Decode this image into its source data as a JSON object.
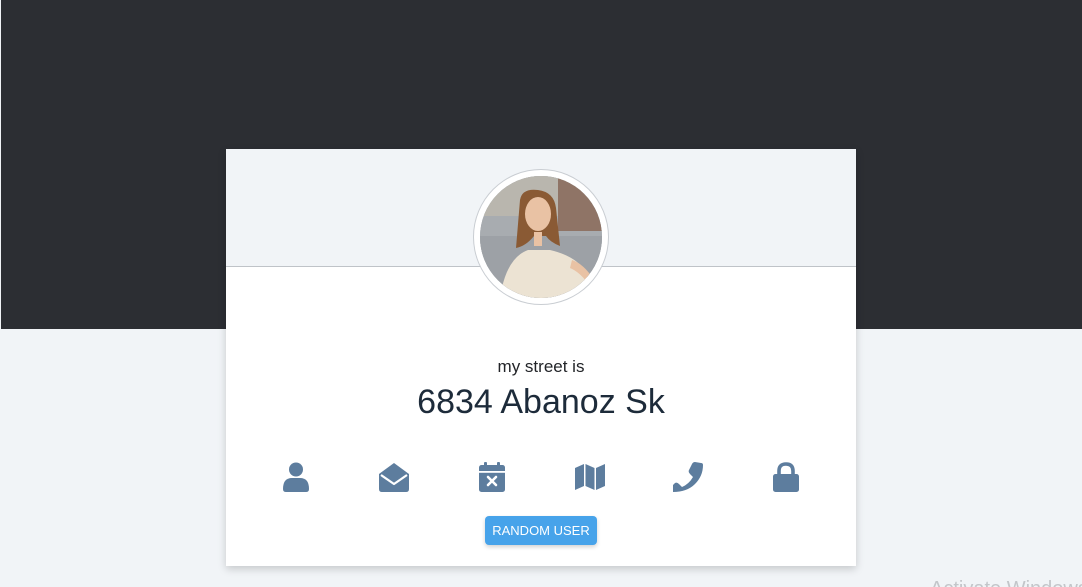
{
  "profile": {
    "label": "my street is",
    "value": "6834 Abanoz Sk",
    "avatar_alt": "user portrait"
  },
  "icons": [
    {
      "name": "user-icon"
    },
    {
      "name": "envelope-open-icon"
    },
    {
      "name": "calendar-times-icon"
    },
    {
      "name": "map-icon"
    },
    {
      "name": "phone-icon"
    },
    {
      "name": "lock-icon"
    }
  ],
  "actions": {
    "random_user_label": "RANDOM USER"
  },
  "system": {
    "watermark_text": "Activate Windows"
  },
  "colors": {
    "top_band": "#2c2e33",
    "page_bg": "#f1f4f7",
    "icon": "#5d7d9e",
    "button": "#47a3ea",
    "value_text": "#1d2b3a"
  }
}
